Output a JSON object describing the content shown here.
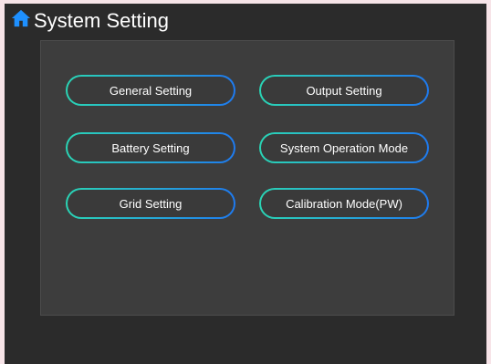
{
  "header": {
    "title": "System Setting",
    "icon": "home-icon",
    "icon_color": "#1e90ff"
  },
  "menu": {
    "general_setting": "General Setting",
    "output_setting": "Output Setting",
    "battery_setting": "Battery Setting",
    "system_operation_mode": "System Operation Mode",
    "grid_setting": "Grid Setting",
    "calibration_mode": "Calibration Mode(PW)"
  },
  "colors": {
    "background": "#2b2b2b",
    "panel": "#3d3d3d",
    "button_border_start": "#2ad4b4",
    "button_border_end": "#1e7af0"
  }
}
